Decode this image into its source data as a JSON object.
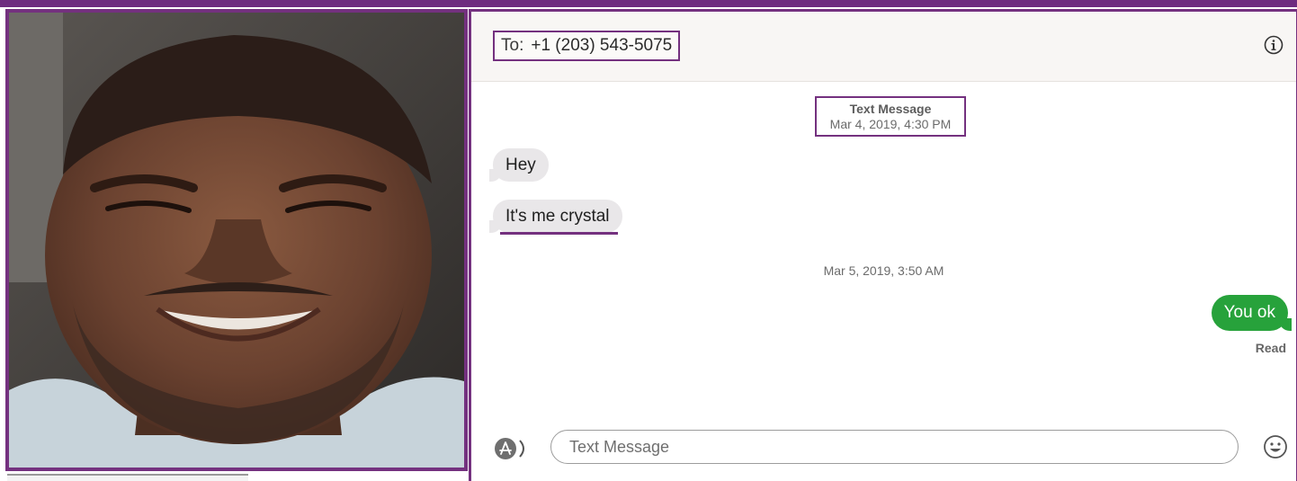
{
  "header": {
    "to_label": "To:",
    "recipient": "+1 (203) 543-5075",
    "info_icon": "info-icon"
  },
  "thread": {
    "stamp1": {
      "type": "Text Message",
      "datetime": "Mar 4, 2019, 4:30 PM"
    },
    "incoming": [
      {
        "text": "Hey"
      },
      {
        "text": "It's me crystal"
      }
    ],
    "stamp2": {
      "datetime": "Mar 5, 2019, 3:50 AM"
    },
    "outgoing": [
      {
        "text": "You ok",
        "status": "Read"
      }
    ]
  },
  "composer": {
    "apps_icon": "app-store-icon",
    "placeholder": "Text Message",
    "emoji_icon": "emoji-icon"
  },
  "colors": {
    "annotation": "#74317f",
    "outgoing_bubble": "#27a23b",
    "incoming_bubble": "#e9e7e9"
  }
}
